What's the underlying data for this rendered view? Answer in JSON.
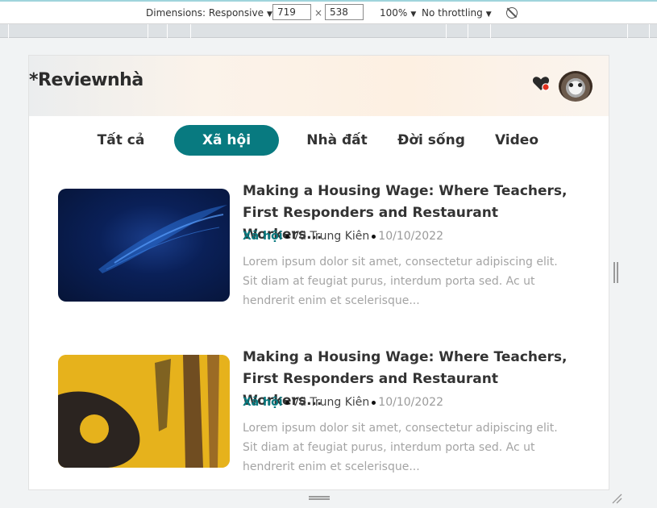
{
  "devtools": {
    "dimensions_label": "Dimensions: Responsive",
    "width": "719",
    "height": "538",
    "zoom": "100%",
    "throttling": "No throttling",
    "times": "×",
    "caret": "▼"
  },
  "site": {
    "logo": "*Reviewnhà",
    "tabs": [
      {
        "label": "Tất cả"
      },
      {
        "label": "Xã hội"
      },
      {
        "label": "Nhà đất"
      },
      {
        "label": "Đời sống"
      },
      {
        "label": "Video"
      }
    ],
    "articles": [
      {
        "title": "Making a Housing Wage: Where Teachers, First Responders and Restaurant Workers...",
        "category": "Xã hội",
        "author": "Vũ Trung Kiên",
        "date": "10/10/2022",
        "excerpt": "Lorem ipsum dolor sit amet, consectetur adipiscing elit. Sit diam at feugiat purus, interdum porta sed. Ac ut hendrerit enim et scelerisque..."
      },
      {
        "title": "Making a Housing Wage: Where Teachers, First Responders and Restaurant Workers...",
        "category": "Xã hội",
        "author": "Vũ Trung Kiên",
        "date": "10/10/2022",
        "excerpt": "Lorem ipsum dolor sit amet, consectetur adipiscing elit. Sit diam at feugiat purus, interdum porta sed. Ac ut hendrerit enim et scelerisque..."
      }
    ]
  },
  "colors": {
    "accent": "#087a80",
    "notification": "#e0301e"
  },
  "icons": {
    "heart": "heart-icon",
    "rotate": "rotate-icon",
    "resize": "resize-grip-icon"
  }
}
